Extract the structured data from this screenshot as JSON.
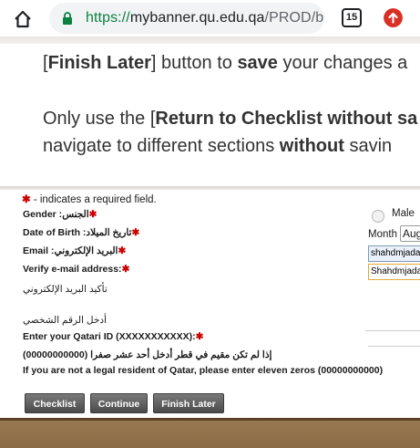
{
  "browser": {
    "url_protocol": "https://",
    "url_host": "mybanner.qu.edu.qa",
    "url_path": "/PROD/bw",
    "tab_count": "15"
  },
  "info": {
    "line1": {
      "a": "[",
      "b": "Finish Later",
      "c": "] button to ",
      "d": "save",
      "e": " your changes a"
    },
    "line2": {
      "a": "Only use the [",
      "b": "Return to Checklist without sa"
    },
    "line3": {
      "a": "navigate to different sections ",
      "b": "without",
      "c": " savin"
    }
  },
  "form": {
    "required_note": " - indicates a required field.",
    "star": "✱",
    "gender_label": "Gender :الجنس",
    "dob_label": "Date of Birth :تاريخ الميلاد",
    "email_label": "Email :البريد الإلكتروني",
    "verify_label": "Verify e-mail address:",
    "verify_label_ar": "تأكيد البريد الإلكتروني",
    "qatari_label_ar": "أدخل الرقم الشخصي",
    "qatari_label": "Enter your Qatari ID (XXXXXXXXXXX):",
    "non_resident_ar": "إذا لم تكن مقيم في قطر أدخل أحد عشر صفرا (00000000000)",
    "non_resident": "If you are not a legal resident of Qatar, please enter eleven zeros (00000000000)",
    "gender_option": "Male",
    "month_label": "Month",
    "month_value": "Aug",
    "email_value": "shahdmjadal",
    "verify_value": "Shahdmjadal"
  },
  "buttons": {
    "checklist": "Checklist",
    "continue": "Continue",
    "finish_later": "Finish Later"
  }
}
